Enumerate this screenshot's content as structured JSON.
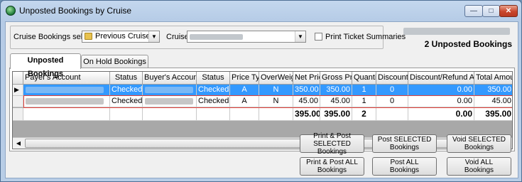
{
  "window": {
    "title": "Unposted Bookings by Cruise",
    "controls": {
      "minimize": "—",
      "maximize": "□",
      "close": "✕"
    }
  },
  "filters": {
    "selection_label": "Cruise Bookings selection:",
    "selection_value": "Previous Cruises",
    "cruise_label": "Cruise:",
    "print_summaries_label": "Print Ticket Summaries",
    "print_summaries_checked": false
  },
  "summary": {
    "count_text": "2  Unposted Bookings"
  },
  "tabs": [
    {
      "label": "Unposted Bookings",
      "active": true
    },
    {
      "label": "On Hold Bookings",
      "active": false
    }
  ],
  "grid": {
    "columns": [
      "Payer's Account",
      "Status",
      "Buyer's Account",
      "Status",
      "Price Type",
      "OverWeight",
      "Net Price",
      "Gross Price",
      "Quantity",
      "Discount %",
      "Discount/Refund Amount",
      "Total Amount"
    ],
    "rows": [
      {
        "selected": true,
        "status": "Checked-In",
        "buyer_status": "Checked-In",
        "price_type": "A",
        "overweight": "N",
        "net": "350.00",
        "gross": "350.00",
        "qty": "1",
        "disc": "0",
        "refund": "0.00",
        "total": "350.00"
      },
      {
        "selected": false,
        "status": "Checked-In",
        "buyer_status": "Checked-In",
        "price_type": "A",
        "overweight": "N",
        "net": "45.00",
        "gross": "45.00",
        "qty": "1",
        "disc": "0",
        "refund": "0.00",
        "total": "45.00"
      }
    ],
    "totals": {
      "net": "395.00",
      "gross": "395.00",
      "qty": "2",
      "refund": "0.00",
      "total": "395.00"
    }
  },
  "buttons": {
    "print_post_selected": "Print & Post SELECTED Bookings",
    "post_selected": "Post SELECTED Bookings",
    "void_selected": "Void SELECTED Bookings",
    "print_post_all": "Print & Post ALL Bookings",
    "post_all": "Post ALL Bookings",
    "void_all": "Void ALL Bookings"
  },
  "icons": {
    "app": "app-globe-icon",
    "folder": "folder-icon",
    "row_pointer": "row-pointer-icon"
  }
}
